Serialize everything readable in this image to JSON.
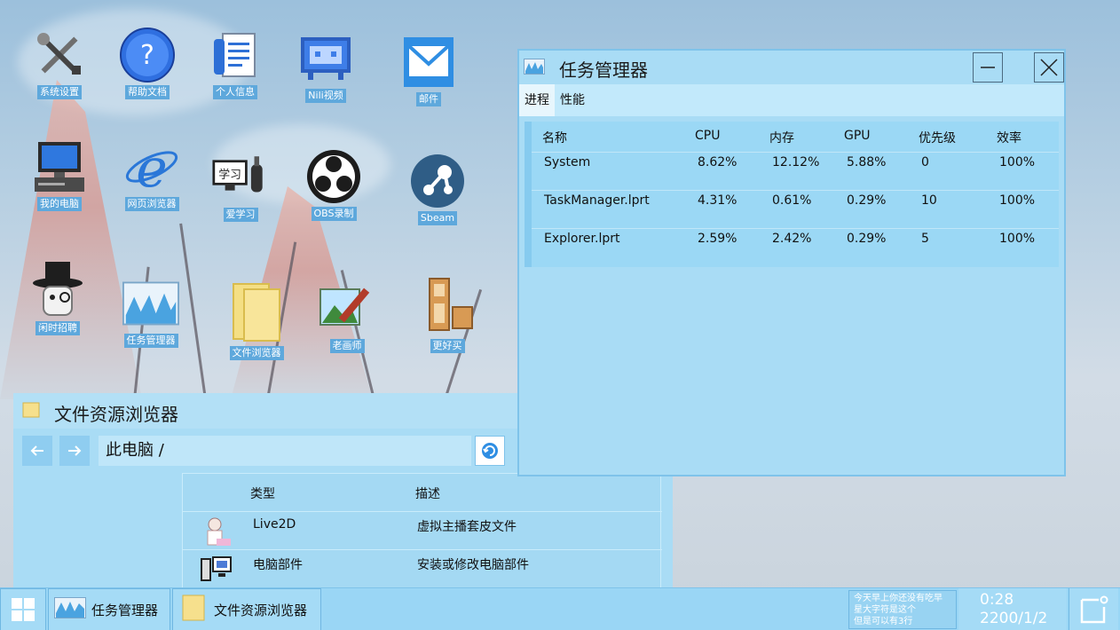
{
  "desktop": {
    "icons": [
      {
        "label": "系统设置",
        "icon": "settings-tools-icon"
      },
      {
        "label": "帮助文档",
        "icon": "help-icon"
      },
      {
        "label": "个人信息",
        "icon": "profile-document-icon"
      },
      {
        "label": "Nili视频",
        "icon": "tv-icon"
      },
      {
        "label": "邮件",
        "icon": "mail-icon"
      },
      {
        "label": "我的电脑",
        "icon": "computer-icon"
      },
      {
        "label": "网页浏览器",
        "icon": "browser-icon"
      },
      {
        "label": "爱学习",
        "icon": "study-icon"
      },
      {
        "label": "OBS录制",
        "icon": "obs-icon"
      },
      {
        "label": "Sbeam",
        "icon": "sbeam-icon"
      },
      {
        "label": "闲时招聘",
        "icon": "hat-ghost-icon"
      },
      {
        "label": "任务管理器",
        "icon": "task-chart-icon"
      },
      {
        "label": "文件浏览器",
        "icon": "folder-icon"
      },
      {
        "label": "老画师",
        "icon": "painting-icon"
      },
      {
        "label": "更好买",
        "icon": "shop-icon"
      }
    ]
  },
  "task_manager": {
    "title": "任务管理器",
    "tabs": [
      "进程",
      "性能"
    ],
    "columns": [
      "名称",
      "CPU",
      "内存",
      "GPU",
      "优先级",
      "效率"
    ],
    "rows": [
      [
        "System",
        "8.62%",
        "12.12%",
        "5.88%",
        "0",
        "100%"
      ],
      [
        "TaskManager.lprt",
        "4.31%",
        "0.61%",
        "0.29%",
        "10",
        "100%"
      ],
      [
        "Explorer.lprt",
        "2.59%",
        "2.42%",
        "0.29%",
        "5",
        "100%"
      ]
    ]
  },
  "file_explorer": {
    "title": "文件资源浏览器",
    "path": "此电脑 /",
    "columns": [
      "类型",
      "描述"
    ],
    "rows": [
      {
        "type": "Live2D",
        "desc": "虚拟主播套皮文件",
        "icon": "live2d-avatar-icon"
      },
      {
        "type": "电脑部件",
        "desc": "安装或修改电脑部件",
        "icon": "computer-parts-icon"
      }
    ]
  },
  "taskbar": {
    "items": [
      {
        "label": "任务管理器",
        "icon": "task-chart-icon"
      },
      {
        "label": "文件资源浏览器",
        "icon": "folder-icon"
      }
    ],
    "note": [
      "今天早上你还没有吃早",
      "星大字符是这个",
      "但是可以有3行"
    ],
    "time": "0:28",
    "date": "2200/1/2"
  },
  "colors": {
    "window_bg": "#a9dcf5",
    "label_bg": "#5ea8dc",
    "taskbar_bg": "#9ad6f5"
  }
}
